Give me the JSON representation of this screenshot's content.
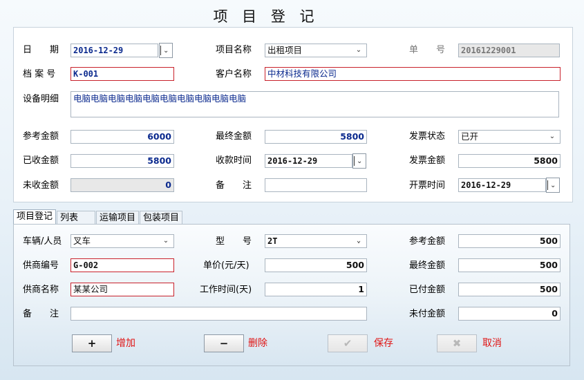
{
  "title": "项 目 登 记",
  "top": {
    "date_label": "日　　期",
    "date_value": "2016-12-29",
    "project_name_label": "项目名称",
    "project_name_value": "出租项目",
    "order_no_label": "单　　号",
    "order_no_value": "20161229001",
    "archive_no_label": "档 案 号",
    "archive_no_value": "K-001",
    "customer_label": "客户名称",
    "customer_value": "中材科技有限公司",
    "equipment_label": "设备明细",
    "equipment_value": "电脑电脑电脑电脑电脑电脑电脑电脑电脑电脑",
    "ref_amount_label": "参考金额",
    "ref_amount_value": "6000",
    "final_amount_label": "最终金额",
    "final_amount_value": "5800",
    "invoice_status_label": "发票状态",
    "invoice_status_value": "已开",
    "received_label": "已收金额",
    "received_value": "5800",
    "receive_time_label": "收款时间",
    "receive_time_value": "2016-12-29",
    "invoice_amount_label": "发票金额",
    "invoice_amount_value": "5800",
    "unreceived_label": "未收金额",
    "unreceived_value": "0",
    "remark_label": "备　　注",
    "remark_value": "",
    "invoice_time_label": "开票时间",
    "invoice_time_value": "2016-12-29"
  },
  "tabs": [
    {
      "label": "项目登记"
    },
    {
      "label": "列表"
    },
    {
      "label": "运输项目"
    },
    {
      "label": "包装项目"
    }
  ],
  "detail": {
    "vehicle_label": "车辆/人员",
    "vehicle_value": "叉车",
    "model_label": "型　　号",
    "model_value": "2T",
    "ref_amount_label": "参考金额",
    "ref_amount_value": "500",
    "supplier_no_label": "供商编号",
    "supplier_no_value": "G-002",
    "unit_price_label": "单价(元/天)",
    "unit_price_value": "500",
    "final_amount_label": "最终金额",
    "final_amount_value": "500",
    "supplier_name_label": "供商名称",
    "supplier_name_value": "某某公司",
    "work_days_label": "工作时间(天)",
    "work_days_value": "1",
    "paid_label": "已付金额",
    "paid_value": "500",
    "remark_label": "备　　注",
    "remark_value": "",
    "unpaid_label": "未付金额",
    "unpaid_value": "0"
  },
  "buttons": {
    "add_symbol": "+",
    "add_label": "增加",
    "delete_symbol": "−",
    "delete_label": "删除",
    "save_symbol": "✔",
    "save_label": "保存",
    "cancel_symbol": "✖",
    "cancel_label": "取消"
  },
  "colors": {
    "required_border": "#c8202a",
    "button_label": "#e01414",
    "value_text": "#0b2a8e"
  }
}
